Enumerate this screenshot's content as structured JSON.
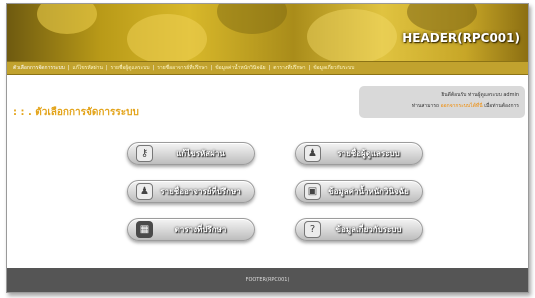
{
  "header": {
    "title": "HEADER(RPC001)"
  },
  "navbar": {
    "items": [
      "ตัวเลือกการจัดการระบบ",
      "แก้ไขรหัสผ่าน",
      "รายชื่อผู้ดูแลระบบ",
      "รายชื่ออาจารย์ที่ปรึกษา",
      "ข้อมูลค่าน้ำหนักวินิจฉัย",
      "ตารางที่ปรึกษา",
      "ข้อมูลเกี่ยวกับระบบ"
    ]
  },
  "page": {
    "title": ": : . ตัวเลือกการจัดการระบบ"
  },
  "user_panel": {
    "line1": "ยินดีต้อนรับ ท่านผู้ดูแลระบบ admin",
    "line2_prefix": "ท่านสามารถ",
    "line2_highlight": "ออกจากระบบได้ที่นี่",
    "line2_suffix": " เมื่อท่านต้องการ"
  },
  "buttons": [
    {
      "label": "แก้ไขรหัสผ่าน",
      "icon": "key-icon"
    },
    {
      "label": "รายชื่อผู้ดูแลระบบ",
      "icon": "user-admin-icon"
    },
    {
      "label": "รายชื่ออาจารย์ที่ปรึกษา",
      "icon": "advisor-icon"
    },
    {
      "label": "ข้อมูลค่าน้ำหนักวินิจฉัย",
      "icon": "image-icon"
    },
    {
      "label": "ตารางที่ปรึกษา",
      "icon": "calendar-icon"
    },
    {
      "label": "ข้อมูลเกี่ยวกับระบบ",
      "icon": "question-icon"
    }
  ],
  "footer": {
    "text": "FOOTER(RPC001)"
  }
}
